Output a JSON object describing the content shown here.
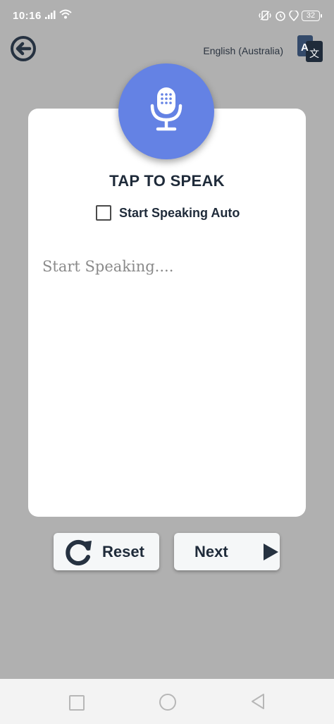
{
  "status_bar": {
    "time": "10:16",
    "battery": "32"
  },
  "header": {
    "language": "English (Australia)"
  },
  "card": {
    "title": "TAP TO SPEAK",
    "auto_label": "Start Speaking Auto",
    "auto_checked": false,
    "speech_placeholder": "Start Speaking...."
  },
  "actions": {
    "reset_label": "Reset",
    "next_label": "Next"
  },
  "icons": {
    "back": "back-arrow-icon",
    "translate": "translate-icon",
    "mic": "microphone-icon",
    "reset": "reset-icon",
    "next": "play-icon"
  },
  "colors": {
    "background": "#b0b0b0",
    "accent": "#6482e4",
    "text_dark": "#1f2b3a",
    "card": "#ffffff"
  }
}
